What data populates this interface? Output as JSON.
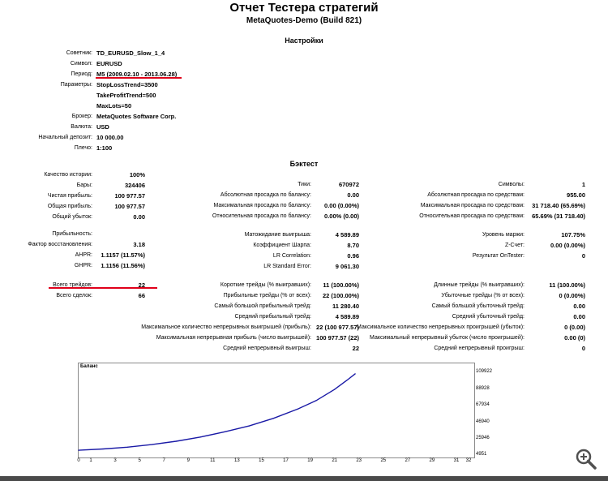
{
  "report": {
    "title": "Отчет Тестера стратегий",
    "subtitle": "MetaQuotes-Demo (Build 821)"
  },
  "settings": {
    "heading": "Настройки",
    "rows": [
      {
        "label": "Советник:",
        "value": "TD_EURUSD_Slow_1_4"
      },
      {
        "label": "Символ:",
        "value": "EURUSD"
      },
      {
        "label": "Период:",
        "value": "M5 (2009.02.10 - 2013.06.28)"
      },
      {
        "label": "Параметры:",
        "value": "StopLossTrend=3500"
      },
      {
        "label": "",
        "value": "TakeProfitTrend=500"
      },
      {
        "label": "",
        "value": "MaxLots=50"
      },
      {
        "label": "Брокер:",
        "value": "MetaQuotes Software Corp."
      },
      {
        "label": "Валюта:",
        "value": "USD"
      },
      {
        "label": "Начальный депозит:",
        "value": "10 000.00"
      },
      {
        "label": "Плечо:",
        "value": "1:100"
      }
    ]
  },
  "backtest": {
    "heading": "Бэктест",
    "col1": [
      {
        "label": "Качество истории:",
        "value": "100%"
      },
      {
        "label": "Бары:",
        "value": "324406"
      },
      {
        "label": "Чистая прибыль:",
        "value": "100 977.57"
      },
      {
        "label": "Общая прибыль:",
        "value": "100 977.57"
      },
      {
        "label": "Общий убыток:",
        "value": "0.00"
      },
      {
        "label": "Прибыльность:",
        "value": ""
      },
      {
        "label": "Фактор восстановления:",
        "value": "3.18"
      },
      {
        "label": "AHPR:",
        "value": "1.1157 (11.57%)"
      },
      {
        "label": "GHPR:",
        "value": "1.1156 (11.56%)"
      },
      {
        "label": "Всего трейдов:",
        "value": "22"
      },
      {
        "label": "Всего сделок:",
        "value": "66"
      }
    ],
    "col2": [
      {
        "label": "Тики:",
        "value": "670972"
      },
      {
        "label": "Абсолютная просадка по балансу:",
        "value": "0.00"
      },
      {
        "label": "Максимальная просадка по балансу:",
        "value": "0.00 (0.00%)"
      },
      {
        "label": "Относительная просадка по балансу:",
        "value": "0.00% (0.00)"
      },
      {
        "label": "Матожидание выигрыша:",
        "value": "4 589.89"
      },
      {
        "label": "Коэффициент Шарпа:",
        "value": "8.70"
      },
      {
        "label": "LR Correlation:",
        "value": "0.96"
      },
      {
        "label": "LR Standard Error:",
        "value": "9 061.30"
      },
      {
        "label": "Короткие трейды (% выигравших):",
        "value": "11 (100.00%)"
      },
      {
        "label": "Прибыльные трейды (% от всех):",
        "value": "22 (100.00%)"
      },
      {
        "label": "Самый большой прибыльный трейд:",
        "value": "11 280.40"
      },
      {
        "label": "Средний прибыльный трейд:",
        "value": "4 589.89"
      },
      {
        "label": "Максимальное количество непрерывных выигрышей (прибыль):",
        "value": "22 (100 977.57)"
      },
      {
        "label": "Максимальная непрерывная прибыль (число выигрышей):",
        "value": "100 977.57 (22)"
      },
      {
        "label": "Средний непрерывный выигрыш:",
        "value": "22"
      }
    ],
    "col3": [
      {
        "label": "Символы:",
        "value": "1"
      },
      {
        "label": "Абсолютная просадка по средствам:",
        "value": "955.00"
      },
      {
        "label": "Максимальная просадка по средствам:",
        "value": "31 718.40 (65.69%)"
      },
      {
        "label": "Относительная просадка по средствам:",
        "value": "65.69% (31 718.40)"
      },
      {
        "label": "Уровень маржи:",
        "value": "107.75%"
      },
      {
        "label": "Z-Счет:",
        "value": "0.00 (0.00%)"
      },
      {
        "label": "Результат OnTester:",
        "value": "0"
      },
      {
        "label": "Длинные трейды (% выигравших):",
        "value": "11 (100.00%)"
      },
      {
        "label": "Убыточные трейды (% от всех):",
        "value": "0 (0.00%)"
      },
      {
        "label": "Самый большой убыточный трейд:",
        "value": "0.00"
      },
      {
        "label": "Средний убыточный трейд:",
        "value": "0.00"
      },
      {
        "label": "Максимальное количество непрерывных проигрышей (убыток):",
        "value": "0 (0.00)"
      },
      {
        "label": "Максимальный непрерывный убыток (число проигрышей):",
        "value": "0.00 (0)"
      },
      {
        "label": "Средний непрерывный проигрыш:",
        "value": "0"
      }
    ]
  },
  "colors": {
    "highlight": "#e0001a",
    "balance_line": "#1a1aa6"
  },
  "chart_data": {
    "type": "line",
    "title": "Баланс",
    "ylim": [
      4951,
      109922
    ],
    "xlim": [
      0,
      32
    ],
    "yticks": [
      "109922",
      "88928",
      "67934",
      "46940",
      "25946",
      "4951"
    ],
    "xticks": [
      "0",
      "1",
      "3",
      "5",
      "7",
      "9",
      "11",
      "13",
      "15",
      "17",
      "19",
      "21",
      "23",
      "25",
      "27",
      "29",
      "31",
      "32"
    ],
    "series": [
      {
        "x": [
          0,
          2,
          4,
          6,
          8,
          10,
          12,
          14,
          16,
          18,
          19.5,
          21,
          22,
          22.7
        ],
        "values": [
          10000,
          11700,
          14000,
          17300,
          21600,
          27000,
          33700,
          41200,
          51000,
          63000,
          73800,
          88000,
          99500,
          108000
        ]
      }
    ]
  },
  "ui": {
    "zoom_icon": "zoom-in-icon"
  }
}
